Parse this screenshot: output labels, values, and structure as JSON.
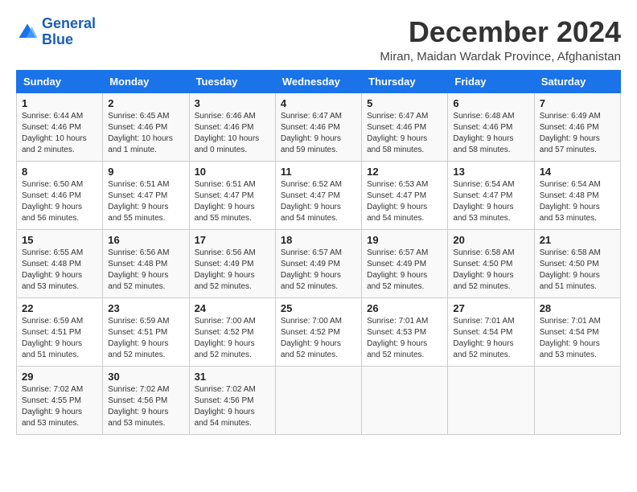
{
  "logo": {
    "line1": "General",
    "line2": "Blue"
  },
  "title": "December 2024",
  "location": "Miran, Maidan Wardak Province, Afghanistan",
  "days_of_week": [
    "Sunday",
    "Monday",
    "Tuesday",
    "Wednesday",
    "Thursday",
    "Friday",
    "Saturday"
  ],
  "weeks": [
    [
      {
        "day": 1,
        "sunrise": "6:44 AM",
        "sunset": "4:46 PM",
        "daylight": "10 hours and 2 minutes."
      },
      {
        "day": 2,
        "sunrise": "6:45 AM",
        "sunset": "4:46 PM",
        "daylight": "10 hours and 1 minute."
      },
      {
        "day": 3,
        "sunrise": "6:46 AM",
        "sunset": "4:46 PM",
        "daylight": "10 hours and 0 minutes."
      },
      {
        "day": 4,
        "sunrise": "6:47 AM",
        "sunset": "4:46 PM",
        "daylight": "9 hours and 59 minutes."
      },
      {
        "day": 5,
        "sunrise": "6:47 AM",
        "sunset": "4:46 PM",
        "daylight": "9 hours and 58 minutes."
      },
      {
        "day": 6,
        "sunrise": "6:48 AM",
        "sunset": "4:46 PM",
        "daylight": "9 hours and 58 minutes."
      },
      {
        "day": 7,
        "sunrise": "6:49 AM",
        "sunset": "4:46 PM",
        "daylight": "9 hours and 57 minutes."
      }
    ],
    [
      {
        "day": 8,
        "sunrise": "6:50 AM",
        "sunset": "4:46 PM",
        "daylight": "9 hours and 56 minutes."
      },
      {
        "day": 9,
        "sunrise": "6:51 AM",
        "sunset": "4:47 PM",
        "daylight": "9 hours and 55 minutes."
      },
      {
        "day": 10,
        "sunrise": "6:51 AM",
        "sunset": "4:47 PM",
        "daylight": "9 hours and 55 minutes."
      },
      {
        "day": 11,
        "sunrise": "6:52 AM",
        "sunset": "4:47 PM",
        "daylight": "9 hours and 54 minutes."
      },
      {
        "day": 12,
        "sunrise": "6:53 AM",
        "sunset": "4:47 PM",
        "daylight": "9 hours and 54 minutes."
      },
      {
        "day": 13,
        "sunrise": "6:54 AM",
        "sunset": "4:47 PM",
        "daylight": "9 hours and 53 minutes."
      },
      {
        "day": 14,
        "sunrise": "6:54 AM",
        "sunset": "4:48 PM",
        "daylight": "9 hours and 53 minutes."
      }
    ],
    [
      {
        "day": 15,
        "sunrise": "6:55 AM",
        "sunset": "4:48 PM",
        "daylight": "9 hours and 53 minutes."
      },
      {
        "day": 16,
        "sunrise": "6:56 AM",
        "sunset": "4:48 PM",
        "daylight": "9 hours and 52 minutes."
      },
      {
        "day": 17,
        "sunrise": "6:56 AM",
        "sunset": "4:49 PM",
        "daylight": "9 hours and 52 minutes."
      },
      {
        "day": 18,
        "sunrise": "6:57 AM",
        "sunset": "4:49 PM",
        "daylight": "9 hours and 52 minutes."
      },
      {
        "day": 19,
        "sunrise": "6:57 AM",
        "sunset": "4:49 PM",
        "daylight": "9 hours and 52 minutes."
      },
      {
        "day": 20,
        "sunrise": "6:58 AM",
        "sunset": "4:50 PM",
        "daylight": "9 hours and 52 minutes."
      },
      {
        "day": 21,
        "sunrise": "6:58 AM",
        "sunset": "4:50 PM",
        "daylight": "9 hours and 51 minutes."
      }
    ],
    [
      {
        "day": 22,
        "sunrise": "6:59 AM",
        "sunset": "4:51 PM",
        "daylight": "9 hours and 51 minutes."
      },
      {
        "day": 23,
        "sunrise": "6:59 AM",
        "sunset": "4:51 PM",
        "daylight": "9 hours and 52 minutes."
      },
      {
        "day": 24,
        "sunrise": "7:00 AM",
        "sunset": "4:52 PM",
        "daylight": "9 hours and 52 minutes."
      },
      {
        "day": 25,
        "sunrise": "7:00 AM",
        "sunset": "4:52 PM",
        "daylight": "9 hours and 52 minutes."
      },
      {
        "day": 26,
        "sunrise": "7:01 AM",
        "sunset": "4:53 PM",
        "daylight": "9 hours and 52 minutes."
      },
      {
        "day": 27,
        "sunrise": "7:01 AM",
        "sunset": "4:54 PM",
        "daylight": "9 hours and 52 minutes."
      },
      {
        "day": 28,
        "sunrise": "7:01 AM",
        "sunset": "4:54 PM",
        "daylight": "9 hours and 53 minutes."
      }
    ],
    [
      {
        "day": 29,
        "sunrise": "7:02 AM",
        "sunset": "4:55 PM",
        "daylight": "9 hours and 53 minutes."
      },
      {
        "day": 30,
        "sunrise": "7:02 AM",
        "sunset": "4:56 PM",
        "daylight": "9 hours and 53 minutes."
      },
      {
        "day": 31,
        "sunrise": "7:02 AM",
        "sunset": "4:56 PM",
        "daylight": "9 hours and 54 minutes."
      },
      null,
      null,
      null,
      null
    ]
  ]
}
